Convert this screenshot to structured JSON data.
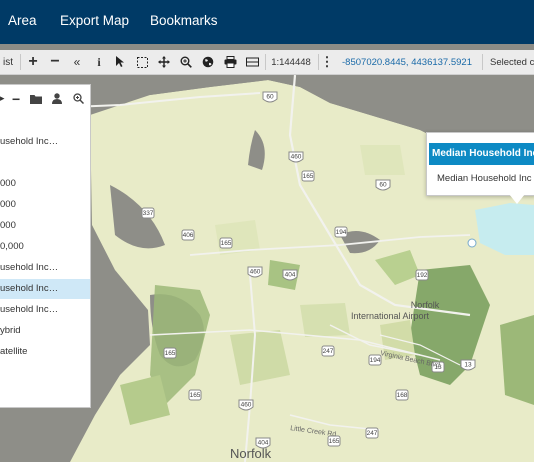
{
  "header": {
    "menu": [
      "Area",
      "Export Map",
      "Bookmarks"
    ]
  },
  "toolbar": {
    "list_label": "ist",
    "scale": "1:144448",
    "coords": "-8507020.8445, 4436137.5921",
    "selected_label": "Selected c"
  },
  "layers_panel": {
    "rows": [
      "usehold Inc…",
      "",
      "000",
      "000",
      "000",
      "0,000",
      "usehold Inc…",
      "usehold Inc…",
      "usehold Inc…",
      "ybrid",
      "atellite"
    ],
    "selected_index": 7
  },
  "popup": {
    "title": "Median Household Inc",
    "body": "Median Household Inc"
  },
  "map": {
    "shields": [
      "60",
      "460",
      "165",
      "337",
      "406",
      "60",
      "165",
      "194",
      "460",
      "404",
      "192",
      "13",
      "165",
      "247",
      "165",
      "460",
      "194",
      "168",
      "13",
      "404",
      "247",
      "165"
    ],
    "labels": [
      "Norfolk\nInternational Airport",
      "Norfolk"
    ],
    "road_labels": [
      "Virginia Beach Blvd",
      "Little Creek Rd"
    ]
  },
  "colors": {
    "header_bg": "#003a66",
    "popup_header": "#0d8ac4",
    "selected_row": "#cfe8f7",
    "link_blue": "#1a6aa8"
  }
}
